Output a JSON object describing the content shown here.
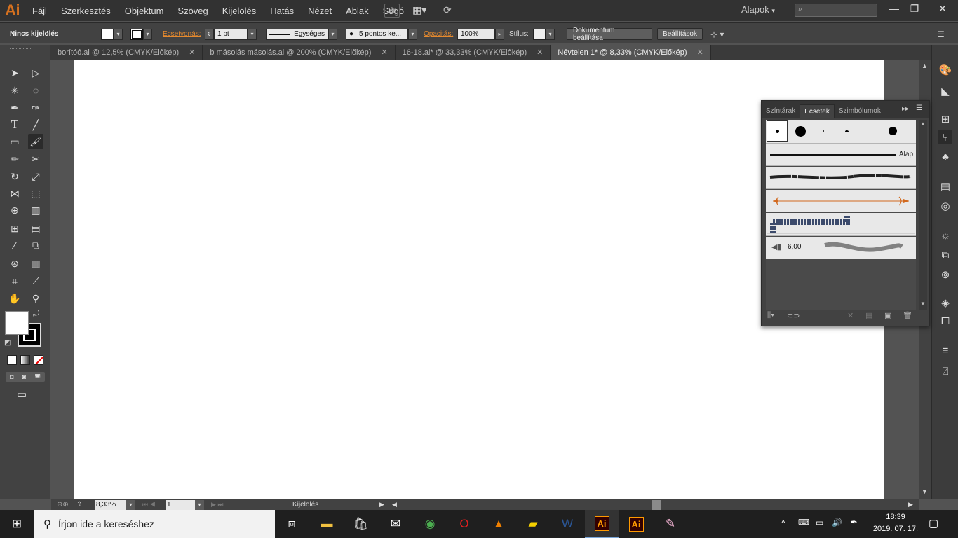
{
  "app": {
    "logo": "Ai"
  },
  "menu": [
    "Fájl",
    "Szerkesztés",
    "Objektum",
    "Szöveg",
    "Kijelölés",
    "Hatás",
    "Nézet",
    "Ablak",
    "Súgó"
  ],
  "menubar_extra": {
    "bridge_label": "Br",
    "workspace": "Alapok",
    "win_min": "—",
    "win_restore": "❐",
    "win_close": "✕"
  },
  "control": {
    "selection_status": "Nincs kijelölés",
    "stroke_label": "Ecsetvonás:",
    "stroke_value": "1 pt",
    "profile_value": "Egységes",
    "brush_value": "5 pontos ke...",
    "opacity_label": "Opacitás:",
    "opacity_value": "100%",
    "style_label": "Stílus:",
    "doc_setup_btn": "Dokumentum beállítása",
    "prefs_btn": "Beállítások"
  },
  "tabs": [
    {
      "label": "borítóó.ai @ 12,5% (CMYK/Előkép)"
    },
    {
      "label": "b másolás másolás.ai @ 200% (CMYK/Előkép)"
    },
    {
      "label": "16-18.ai* @ 33,33% (CMYK/Előkép)"
    },
    {
      "label": "Névtelen 1* @ 8,33% (CMYK/Előkép)"
    }
  ],
  "tab_close": "✕",
  "panel": {
    "tabs": [
      "Színtárak",
      "Ecsetek",
      "Szimbólumok"
    ],
    "active_tab": "Ecsetek",
    "brush_basic_label": "Alap",
    "bristle_size": "6,00"
  },
  "status": {
    "zoom": "8,33%",
    "artboard": "1",
    "tool": "Kijelölés"
  },
  "taskbar": {
    "search_placeholder": "Írjon ide a kereséshez",
    "time": "18:39",
    "date": "2019. 07. 17."
  },
  "colors": {
    "accent": "#e68a2e",
    "ai_orange": "#ff9a00",
    "ai_bg": "#330000",
    "chrome": "#424242",
    "artboard": "#ffffff"
  }
}
